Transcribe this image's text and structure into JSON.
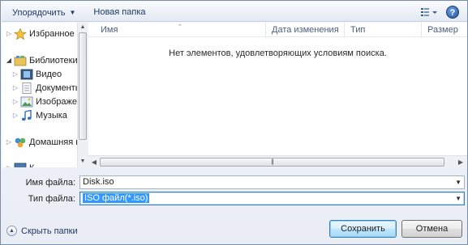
{
  "toolbar": {
    "organize_label": "Упорядочить",
    "new_folder_label": "Новая папка"
  },
  "nav": {
    "favorites": "Избранное",
    "libraries": "Библиотеки",
    "video": "Видео",
    "documents": "Документы",
    "images": "Изображения",
    "music": "Музыка",
    "homegroup": "Домашняя группа",
    "computer": "К"
  },
  "columns": {
    "name": "Имя",
    "date_modified": "Дата изменения",
    "type": "Тип",
    "size": "Размер"
  },
  "empty_message": "Нет элементов, удовлетворяющих условиям поиска.",
  "filename": {
    "label": "Имя файла:",
    "value": "Disk.iso"
  },
  "filetype": {
    "label": "Тип файла:",
    "value": "ISO файл(*.iso)"
  },
  "footer": {
    "hide_folders_label": "Скрыть папки",
    "save_label": "Сохранить",
    "cancel_label": "Отмена"
  },
  "icons": {
    "view": "view-options-icon",
    "help": "help-icon"
  },
  "colors": {
    "selection": "#3399ff",
    "toolbar_text": "#1e3a64"
  }
}
